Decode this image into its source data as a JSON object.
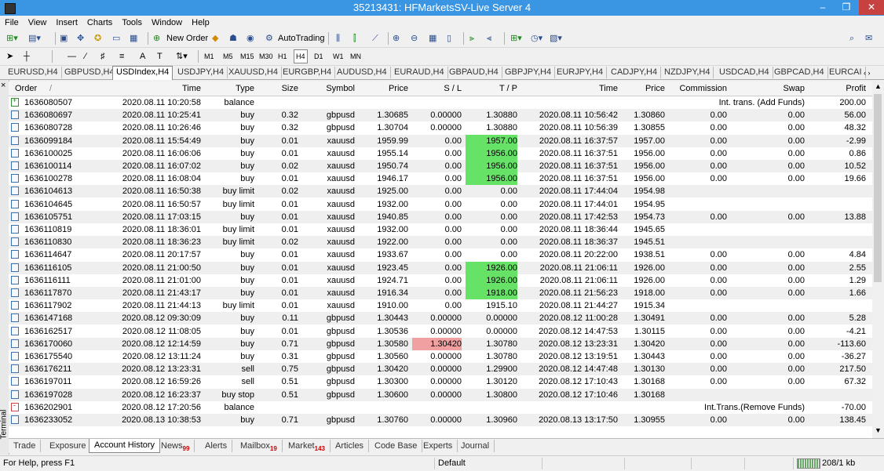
{
  "window": {
    "title": "35213431: HFMarketsSV-Live Server 4",
    "min_glyph": "–",
    "max_glyph": "❐",
    "close_glyph": "✕"
  },
  "menu": [
    "File",
    "View",
    "Insert",
    "Charts",
    "Tools",
    "Window",
    "Help"
  ],
  "toolbar": {
    "new_order": "New Order",
    "autotrading": "AutoTrading",
    "timeframes": [
      "M1",
      "M5",
      "M15",
      "M30",
      "H1",
      "H4",
      "D1",
      "W1",
      "MN"
    ],
    "active_timeframe": "H4"
  },
  "chart_tabs": [
    "EURUSD,H4",
    "GBPUSD,H4",
    "USDIndex,H4",
    "USDJPY,H4",
    "XAUUSD,H4",
    "EURGBP,H4",
    "AUDUSD,H4",
    "EURAUD,H4",
    "GBPAUD,H4",
    "GBPJPY,H4",
    "EURJPY,H4",
    "CADJPY,H4",
    "NZDJPY,H4",
    "USDCAD,H4",
    "GBPCAD,H4",
    "EURCAI"
  ],
  "active_chart_tab": "USDIndex,H4",
  "columns": {
    "order": "Order",
    "order_sort": "/",
    "time": "Time",
    "type": "Type",
    "size": "Size",
    "symbol": "Symbol",
    "price": "Price",
    "sl": "S / L",
    "tp": "T / P",
    "close_time": "Time",
    "close_price": "Price",
    "commission": "Commission",
    "swap": "Swap",
    "profit": "Profit"
  },
  "rows": [
    {
      "order": "1636080507",
      "time": "2020.08.11 10:20:58",
      "type": "balance",
      "comment": "Int. trans. (Add Funds)",
      "profit": "200.00",
      "kind": "balance"
    },
    {
      "order": "1636080697",
      "time": "2020.08.11 10:25:41",
      "type": "buy",
      "size": "0.32",
      "symbol": "gbpusd",
      "price": "1.30685",
      "sl": "0.00000",
      "tp": "1.30880",
      "ctime": "2020.08.11 10:56:42",
      "cprice": "1.30860",
      "comm": "0.00",
      "swap": "0.00",
      "profit": "56.00"
    },
    {
      "order": "1636080728",
      "time": "2020.08.11 10:26:46",
      "type": "buy",
      "size": "0.32",
      "symbol": "gbpusd",
      "price": "1.30704",
      "sl": "0.00000",
      "tp": "1.30880",
      "ctime": "2020.08.11 10:56:39",
      "cprice": "1.30855",
      "comm": "0.00",
      "swap": "0.00",
      "profit": "48.32"
    },
    {
      "order": "1636099184",
      "time": "2020.08.11 15:54:49",
      "type": "buy",
      "size": "0.01",
      "symbol": "xauusd",
      "price": "1959.99",
      "sl": "0.00",
      "tp": "1957.00",
      "tp_hl": "green",
      "ctime": "2020.08.11 16:37:57",
      "cprice": "1957.00",
      "comm": "0.00",
      "swap": "0.00",
      "profit": "-2.99"
    },
    {
      "order": "1636100025",
      "time": "2020.08.11 16:06:06",
      "type": "buy",
      "size": "0.01",
      "symbol": "xauusd",
      "price": "1955.14",
      "sl": "0.00",
      "tp": "1956.00",
      "tp_hl": "green",
      "ctime": "2020.08.11 16:37:51",
      "cprice": "1956.00",
      "comm": "0.00",
      "swap": "0.00",
      "profit": "0.86"
    },
    {
      "order": "1636100114",
      "time": "2020.08.11 16:07:02",
      "type": "buy",
      "size": "0.02",
      "symbol": "xauusd",
      "price": "1950.74",
      "sl": "0.00",
      "tp": "1956.00",
      "tp_hl": "green",
      "ctime": "2020.08.11 16:37:51",
      "cprice": "1956.00",
      "comm": "0.00",
      "swap": "0.00",
      "profit": "10.52"
    },
    {
      "order": "1636100278",
      "time": "2020.08.11 16:08:04",
      "type": "buy",
      "size": "0.01",
      "symbol": "xauusd",
      "price": "1946.17",
      "sl": "0.00",
      "tp": "1956.00",
      "tp_hl": "green",
      "ctime": "2020.08.11 16:37:51",
      "cprice": "1956.00",
      "comm": "0.00",
      "swap": "0.00",
      "profit": "19.66"
    },
    {
      "order": "1636104613",
      "time": "2020.08.11 16:50:38",
      "type": "buy limit",
      "size": "0.02",
      "symbol": "xauusd",
      "price": "1925.00",
      "sl": "0.00",
      "tp": "0.00",
      "ctime": "2020.08.11 17:44:04",
      "cprice": "1954.98",
      "comm": "",
      "swap": "",
      "profit": ""
    },
    {
      "order": "1636104645",
      "time": "2020.08.11 16:50:57",
      "type": "buy limit",
      "size": "0.01",
      "symbol": "xauusd",
      "price": "1932.00",
      "sl": "0.00",
      "tp": "0.00",
      "ctime": "2020.08.11 17:44:01",
      "cprice": "1954.95",
      "comm": "",
      "swap": "",
      "profit": ""
    },
    {
      "order": "1636105751",
      "time": "2020.08.11 17:03:15",
      "type": "buy",
      "size": "0.01",
      "symbol": "xauusd",
      "price": "1940.85",
      "sl": "0.00",
      "tp": "0.00",
      "ctime": "2020.08.11 17:42:53",
      "cprice": "1954.73",
      "comm": "0.00",
      "swap": "0.00",
      "profit": "13.88"
    },
    {
      "order": "1636110819",
      "time": "2020.08.11 18:36:01",
      "type": "buy limit",
      "size": "0.01",
      "symbol": "xauusd",
      "price": "1932.00",
      "sl": "0.00",
      "tp": "0.00",
      "ctime": "2020.08.11 18:36:44",
      "cprice": "1945.65",
      "comm": "",
      "swap": "",
      "profit": ""
    },
    {
      "order": "1636110830",
      "time": "2020.08.11 18:36:23",
      "type": "buy limit",
      "size": "0.02",
      "symbol": "xauusd",
      "price": "1922.00",
      "sl": "0.00",
      "tp": "0.00",
      "ctime": "2020.08.11 18:36:37",
      "cprice": "1945.51",
      "comm": "",
      "swap": "",
      "profit": ""
    },
    {
      "order": "1636114647",
      "time": "2020.08.11 20:17:57",
      "type": "buy",
      "size": "0.01",
      "symbol": "xauusd",
      "price": "1933.67",
      "sl": "0.00",
      "tp": "0.00",
      "ctime": "2020.08.11 20:22:00",
      "cprice": "1938.51",
      "comm": "0.00",
      "swap": "0.00",
      "profit": "4.84"
    },
    {
      "order": "1636116105",
      "time": "2020.08.11 21:00:50",
      "type": "buy",
      "size": "0.01",
      "symbol": "xauusd",
      "price": "1923.45",
      "sl": "0.00",
      "tp": "1926.00",
      "tp_hl": "green",
      "ctime": "2020.08.11 21:06:11",
      "cprice": "1926.00",
      "comm": "0.00",
      "swap": "0.00",
      "profit": "2.55"
    },
    {
      "order": "1636116111",
      "time": "2020.08.11 21:01:00",
      "type": "buy",
      "size": "0.01",
      "symbol": "xauusd",
      "price": "1924.71",
      "sl": "0.00",
      "tp": "1926.00",
      "tp_hl": "green",
      "ctime": "2020.08.11 21:06:11",
      "cprice": "1926.00",
      "comm": "0.00",
      "swap": "0.00",
      "profit": "1.29"
    },
    {
      "order": "1636117870",
      "time": "2020.08.11 21:43:17",
      "type": "buy",
      "size": "0.01",
      "symbol": "xauusd",
      "price": "1916.34",
      "sl": "0.00",
      "tp": "1918.00",
      "tp_hl": "green",
      "ctime": "2020.08.11 21:56:23",
      "cprice": "1918.00",
      "comm": "0.00",
      "swap": "0.00",
      "profit": "1.66"
    },
    {
      "order": "1636117902",
      "time": "2020.08.11 21:44:13",
      "type": "buy limit",
      "size": "0.01",
      "symbol": "xauusd",
      "price": "1910.00",
      "sl": "0.00",
      "tp": "1915.10",
      "ctime": "2020.08.11 21:44:27",
      "cprice": "1915.34",
      "comm": "",
      "swap": "",
      "profit": ""
    },
    {
      "order": "1636147168",
      "time": "2020.08.12 09:30:09",
      "type": "buy",
      "size": "0.11",
      "symbol": "gbpusd",
      "price": "1.30443",
      "sl": "0.00000",
      "tp": "0.00000",
      "ctime": "2020.08.12 11:00:28",
      "cprice": "1.30491",
      "comm": "0.00",
      "swap": "0.00",
      "profit": "5.28"
    },
    {
      "order": "1636162517",
      "time": "2020.08.12 11:08:05",
      "type": "buy",
      "size": "0.01",
      "symbol": "gbpusd",
      "price": "1.30536",
      "sl": "0.00000",
      "tp": "0.00000",
      "ctime": "2020.08.12 14:47:53",
      "cprice": "1.30115",
      "comm": "0.00",
      "swap": "0.00",
      "profit": "-4.21"
    },
    {
      "order": "1636170060",
      "time": "2020.08.12 12:14:59",
      "type": "buy",
      "size": "0.71",
      "symbol": "gbpusd",
      "price": "1.30580",
      "sl": "1.30420",
      "sl_hl": "pink",
      "tp": "1.30780",
      "ctime": "2020.08.12 13:23:31",
      "cprice": "1.30420",
      "comm": "0.00",
      "swap": "0.00",
      "profit": "-113.60"
    },
    {
      "order": "1636175540",
      "time": "2020.08.12 13:11:24",
      "type": "buy",
      "size": "0.31",
      "symbol": "gbpusd",
      "price": "1.30560",
      "sl": "0.00000",
      "tp": "1.30780",
      "ctime": "2020.08.12 13:19:51",
      "cprice": "1.30443",
      "comm": "0.00",
      "swap": "0.00",
      "profit": "-36.27"
    },
    {
      "order": "1636176211",
      "time": "2020.08.12 13:23:31",
      "type": "sell",
      "size": "0.75",
      "symbol": "gbpusd",
      "price": "1.30420",
      "sl": "0.00000",
      "tp": "1.29900",
      "ctime": "2020.08.12 14:47:48",
      "cprice": "1.30130",
      "comm": "0.00",
      "swap": "0.00",
      "profit": "217.50",
      "sell": true
    },
    {
      "order": "1636197011",
      "time": "2020.08.12 16:59:26",
      "type": "sell",
      "size": "0.51",
      "symbol": "gbpusd",
      "price": "1.30300",
      "sl": "0.00000",
      "tp": "1.30120",
      "ctime": "2020.08.12 17:10:43",
      "cprice": "1.30168",
      "comm": "0.00",
      "swap": "0.00",
      "profit": "67.32",
      "sell": true
    },
    {
      "order": "1636197028",
      "time": "2020.08.12 16:23:37",
      "type": "buy stop",
      "size": "0.51",
      "symbol": "gbpusd",
      "price": "1.30600",
      "sl": "0.00000",
      "tp": "1.30800",
      "ctime": "2020.08.12 17:10:46",
      "cprice": "1.30168",
      "comm": "",
      "swap": "",
      "profit": ""
    },
    {
      "order": "1636202901",
      "time": "2020.08.12 17:20:56",
      "type": "balance",
      "comment": "Int.Trans.(Remove Funds)",
      "profit": "-70.00",
      "kind": "balance",
      "negative": true
    },
    {
      "order": "1636233052",
      "time": "2020.08.13 10:38:53",
      "type": "buy",
      "size": "0.71",
      "symbol": "gbpusd",
      "price": "1.30760",
      "sl": "0.00000",
      "tp": "1.30960",
      "ctime": "2020.08.13 13:17:50",
      "cprice": "1.30955",
      "comm": "0.00",
      "swap": "0.00",
      "profit": "138.45"
    }
  ],
  "bottom_tabs": [
    {
      "label": "Trade"
    },
    {
      "label": "Exposure"
    },
    {
      "label": "Account History",
      "active": true
    },
    {
      "label": "News",
      "badge": "99"
    },
    {
      "label": "Alerts"
    },
    {
      "label": "Mailbox",
      "badge": "19"
    },
    {
      "label": "Market",
      "badge": "143"
    },
    {
      "label": "Articles"
    },
    {
      "label": "Code Base"
    },
    {
      "label": "Experts"
    },
    {
      "label": "Journal"
    }
  ],
  "terminal_label": "Terminal",
  "status": {
    "help": "For Help, press F1",
    "profile": "Default",
    "traffic": "208/1 kb"
  }
}
